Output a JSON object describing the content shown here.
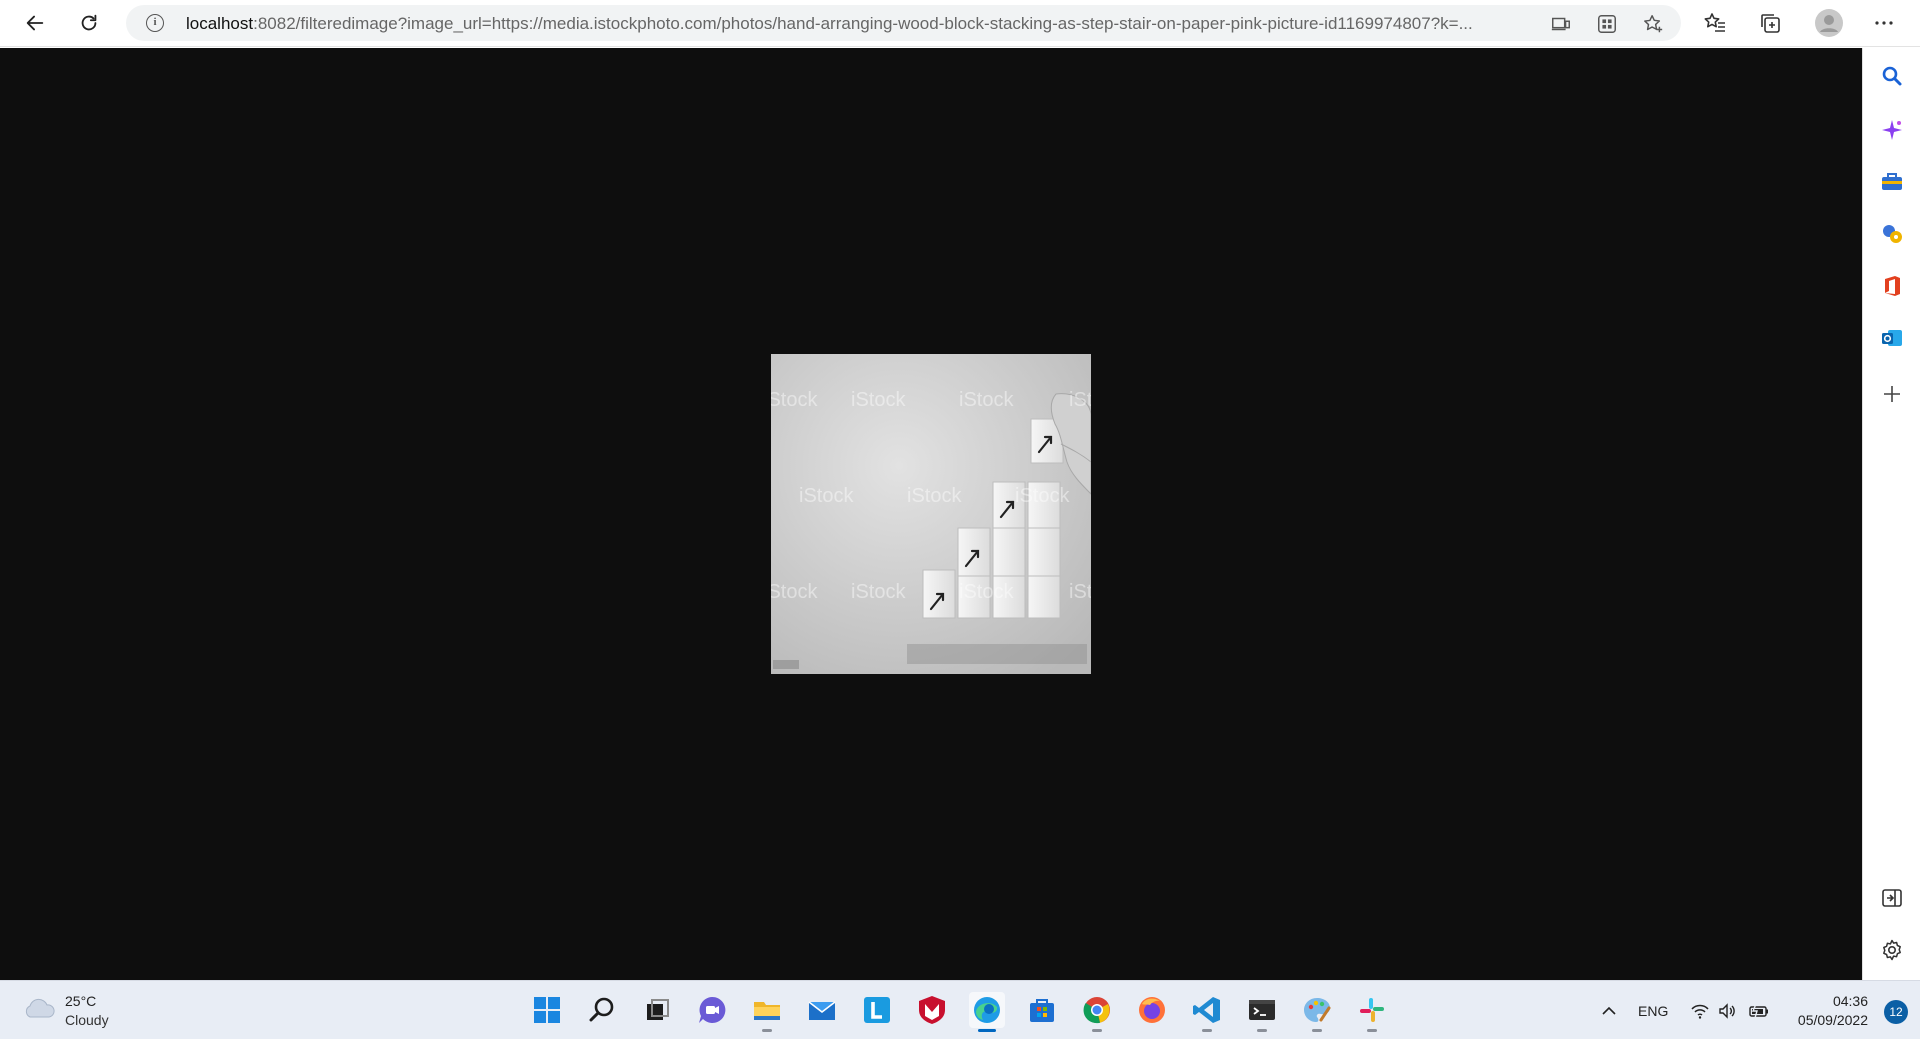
{
  "browser": {
    "url_host": "localhost",
    "url_rest": ":8082/filteredimage?image_url=https://media.istockphoto.com/photos/hand-arranging-wood-block-stacking-as-step-stair-on-paper-pink-picture-id1169974807?k=...",
    "icons": [
      "back-arrow-icon",
      "refresh-icon",
      "info-icon",
      "read-aloud-icon",
      "app-grid-icon",
      "add-favorite-icon",
      "favorites-icon",
      "collections-icon",
      "profile-icon",
      "more-icon"
    ]
  },
  "content": {
    "image_description_only": false,
    "watermark": "iStock"
  },
  "sidebar": {
    "icons": [
      "search-icon",
      "sparkle-icon",
      "briefcase-icon",
      "games-icon",
      "office-icon",
      "outlook-icon",
      "add-icon",
      "hide-sidebar-icon",
      "settings-icon"
    ]
  },
  "taskbar": {
    "weather_temp": "25°C",
    "weather_condition": "Cloudy",
    "language": "ENG",
    "time": "04:36",
    "date": "05/09/2022",
    "notification_count": "12",
    "apps": [
      "start",
      "search",
      "task-view",
      "chat",
      "file-explorer",
      "mail",
      "l-app",
      "mcafee",
      "edge",
      "store",
      "chrome",
      "firefox",
      "vscode",
      "terminal",
      "paint",
      "slack"
    ]
  },
  "colors": {
    "viewport_bg": "#0e0e0e",
    "taskbar_bg": "#e8edf5",
    "accent": "#0067c0"
  }
}
